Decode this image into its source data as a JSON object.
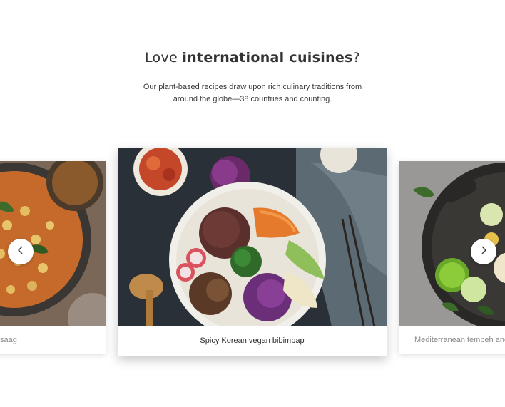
{
  "section": {
    "title_prefix": "Love ",
    "title_bold": "international cuisines",
    "title_suffix": "?",
    "subtitle": "Our plant-based recipes draw upon rich culinary traditions from around the globe—38 countries and counting."
  },
  "carousel": {
    "cards": [
      {
        "caption": "saag",
        "image": "chickpea-curry-photo"
      },
      {
        "caption": "Spicy Korean vegan bibimbap",
        "image": "bibimbap-photo"
      },
      {
        "caption": "Mediterranean tempeh and",
        "image": "tempeh-skillet-photo"
      }
    ],
    "prev_icon": "chevron-left-icon",
    "next_icon": "chevron-right-icon"
  }
}
